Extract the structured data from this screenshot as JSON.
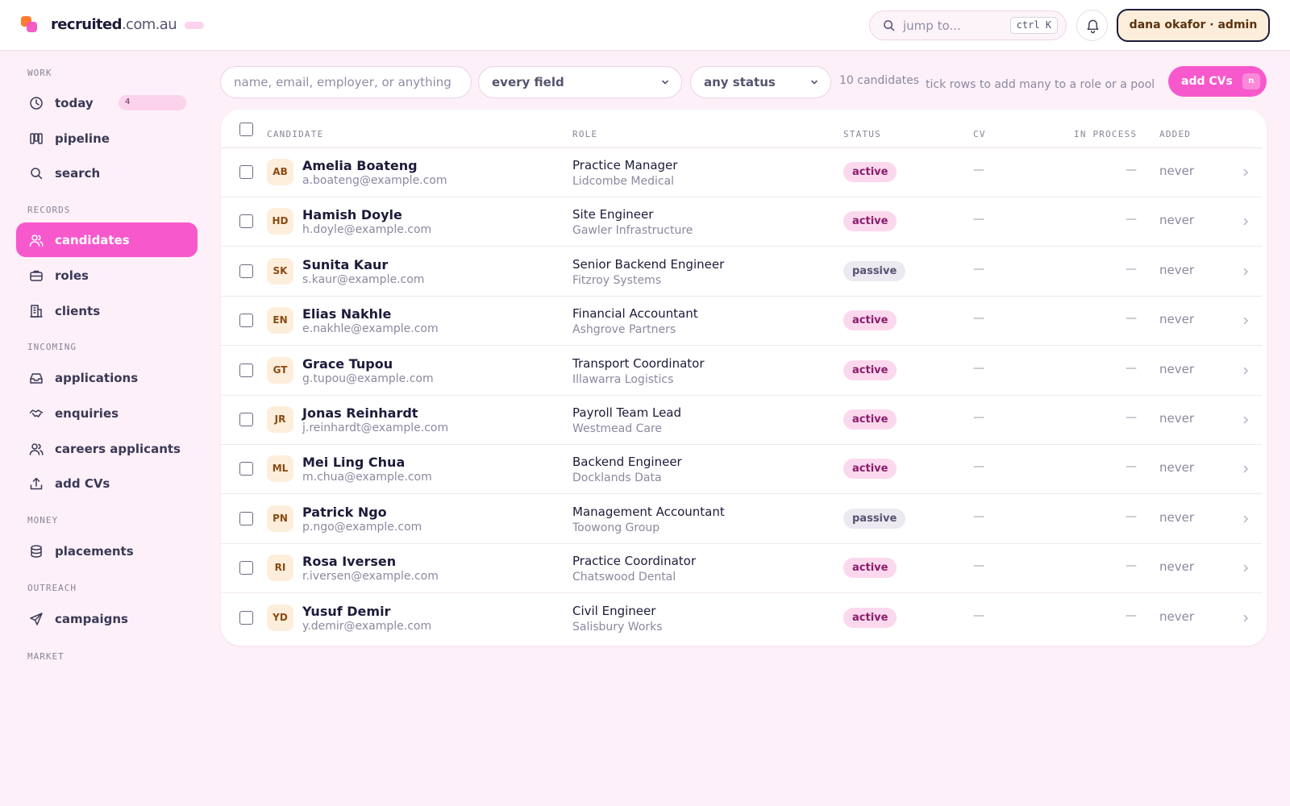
{
  "header": {
    "brand_strong": "recruited",
    "brand_light": ".com.au",
    "jump_placeholder": "jump to...",
    "jump_shortcut": "ctrl K",
    "user_label": "dana okafor · admin"
  },
  "sidebar": {
    "sections": {
      "work": "work",
      "records": "records",
      "incoming": "incoming",
      "money": "money",
      "outreach": "outreach",
      "market": "market"
    },
    "items": {
      "today": "today",
      "today_badge": "4",
      "pipeline": "pipeline",
      "search": "search",
      "candidates": "candidates",
      "roles": "roles",
      "clients": "clients",
      "applications": "applications",
      "enquiries": "enquiries",
      "careers_applicants": "careers applicants",
      "add_cvs": "add CVs",
      "placements": "placements",
      "campaigns": "campaigns"
    }
  },
  "toolbar": {
    "search_placeholder": "name, email, employer, or anything",
    "field_select": "every field",
    "status_select": "any status",
    "count": "10 candidates",
    "hint": "tick rows to add many to a role or a pool",
    "add_button": "add CVs",
    "add_shortcut": "n"
  },
  "table": {
    "columns": {
      "candidate": "candidate",
      "role": "role",
      "status": "status",
      "cv": "cv",
      "in_process": "in process",
      "added": "added"
    },
    "rows": [
      {
        "initials": "AB",
        "name": "Amelia Boateng",
        "email": "a.boateng@example.com",
        "role": "Practice Manager",
        "employer": "Lidcombe Medical",
        "status": "active",
        "cv": "—",
        "in_process": "—",
        "added": "never"
      },
      {
        "initials": "HD",
        "name": "Hamish Doyle",
        "email": "h.doyle@example.com",
        "role": "Site Engineer",
        "employer": "Gawler Infrastructure",
        "status": "active",
        "cv": "—",
        "in_process": "—",
        "added": "never"
      },
      {
        "initials": "SK",
        "name": "Sunita Kaur",
        "email": "s.kaur@example.com",
        "role": "Senior Backend Engineer",
        "employer": "Fitzroy Systems",
        "status": "passive",
        "cv": "—",
        "in_process": "—",
        "added": "never"
      },
      {
        "initials": "EN",
        "name": "Elias Nakhle",
        "email": "e.nakhle@example.com",
        "role": "Financial Accountant",
        "employer": "Ashgrove Partners",
        "status": "active",
        "cv": "—",
        "in_process": "—",
        "added": "never"
      },
      {
        "initials": "GT",
        "name": "Grace Tupou",
        "email": "g.tupou@example.com",
        "role": "Transport Coordinator",
        "employer": "Illawarra Logistics",
        "status": "active",
        "cv": "—",
        "in_process": "—",
        "added": "never"
      },
      {
        "initials": "JR",
        "name": "Jonas Reinhardt",
        "email": "j.reinhardt@example.com",
        "role": "Payroll Team Lead",
        "employer": "Westmead Care",
        "status": "active",
        "cv": "—",
        "in_process": "—",
        "added": "never"
      },
      {
        "initials": "ML",
        "name": "Mei Ling Chua",
        "email": "m.chua@example.com",
        "role": "Backend Engineer",
        "employer": "Docklands Data",
        "status": "active",
        "cv": "—",
        "in_process": "—",
        "added": "never"
      },
      {
        "initials": "PN",
        "name": "Patrick Ngo",
        "email": "p.ngo@example.com",
        "role": "Management Accountant",
        "employer": "Toowong Group",
        "status": "passive",
        "cv": "—",
        "in_process": "—",
        "added": "never"
      },
      {
        "initials": "RI",
        "name": "Rosa Iversen",
        "email": "r.iversen@example.com",
        "role": "Practice Coordinator",
        "employer": "Chatswood Dental",
        "status": "active",
        "cv": "—",
        "in_process": "—",
        "added": "never"
      },
      {
        "initials": "YD",
        "name": "Yusuf Demir",
        "email": "y.demir@example.com",
        "role": "Civil Engineer",
        "employer": "Salisbury Works",
        "status": "active",
        "cv": "—",
        "in_process": "—",
        "added": "never"
      }
    ]
  },
  "colors": {
    "accent": "#f759cd",
    "background": "#fdf0f8",
    "ink": "#1c1b3a"
  }
}
